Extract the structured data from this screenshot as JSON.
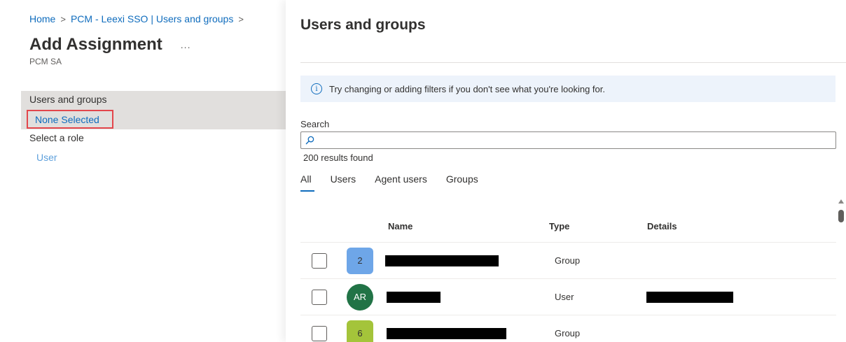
{
  "left": {
    "breadcrumb": [
      "Home",
      "PCM - Leexi SSO | Users and groups"
    ],
    "breadcrumb_sep": ">",
    "title": "Add Assignment",
    "more_glyph": "...",
    "subtitle": "PCM SA",
    "users_groups_label": "Users and groups",
    "users_groups_value": "None Selected",
    "role_label": "Select a role",
    "role_value": "User"
  },
  "right": {
    "title": "Users and groups",
    "info_icon_glyph": "i",
    "info_message": "Try changing or adding filters if you don't see what you're looking for.",
    "search_label": "Search",
    "search_value": "",
    "search_icon": "search-icon",
    "results_count": "200 results found",
    "tabs": [
      "All",
      "Users",
      "Agent users",
      "Groups"
    ],
    "active_tab": "All",
    "columns": [
      "Name",
      "Type",
      "Details"
    ],
    "rows": [
      {
        "avatar_text": "2",
        "avatar_color": "#6ea6e8",
        "avatar_shape": "square",
        "type": "Group",
        "name_redacted": true,
        "details_redacted": false
      },
      {
        "avatar_text": "AR",
        "avatar_color": "#217346",
        "avatar_shape": "circle",
        "type": "User",
        "name_redacted": true,
        "details_redacted": true
      },
      {
        "avatar_text": "6",
        "avatar_color": "#a4c43a",
        "avatar_shape": "square",
        "type": "Group",
        "name_redacted": true,
        "details_redacted": false
      }
    ]
  },
  "colors": {
    "link": "#0f6cbd",
    "highlight_border": "#e3464b",
    "selected_band": "#e1dfdd",
    "info_bar_bg": "#edf3fb"
  }
}
